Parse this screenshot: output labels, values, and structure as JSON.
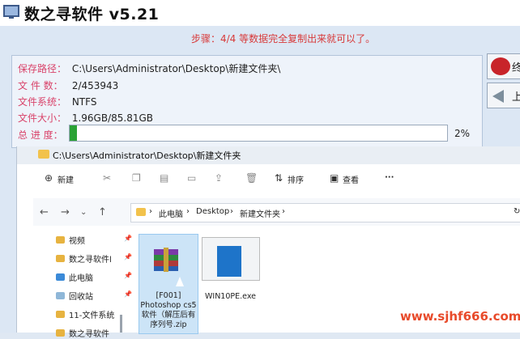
{
  "app": {
    "title": "数之寻软件 v5.21"
  },
  "step_text": "步骤：4/4 等数据完全复制出来就可以了。",
  "info": {
    "save_path_label": "保存路径：",
    "save_path_value": "C:\\Users\\Administrator\\Desktop\\新建文件夹\\",
    "file_count_label": "文 件 数：",
    "file_count_value": "2/453943",
    "fs_label": "文件系统：",
    "fs_value": "NTFS",
    "size_label": "文件大小：",
    "size_value": "1.96GB/85.81GB",
    "progress_label": "总 进 度：",
    "progress_text": "2%",
    "progress_fraction": 0.02
  },
  "side_buttons": {
    "stop_label": "终",
    "back_label": "上"
  },
  "explorer": {
    "title": "C:\\Users\\Administrator\\Desktop\\新建文件夹",
    "toolbar": {
      "new_label": "新建",
      "sort_label": "排序",
      "view_label": "查看",
      "more": "···"
    },
    "breadcrumb": [
      "此电脑",
      "Desktop",
      "新建文件夹"
    ],
    "sidebar": [
      {
        "label": "视频"
      },
      {
        "label": "数之寻软件l"
      },
      {
        "label": "此电脑"
      },
      {
        "label": "回收站"
      },
      {
        "label": "11-文件系统"
      },
      {
        "label": "数之寻软件"
      }
    ],
    "files": [
      {
        "name": "[F001] Photoshop cs5 软件（解压后有序列号.zip"
      },
      {
        "name": "WIN10PE.exe"
      }
    ]
  },
  "watermark": "www.sjhf666.com",
  "colors": {
    "accent_red": "#d9436a",
    "progress_green": "#2aa235"
  }
}
